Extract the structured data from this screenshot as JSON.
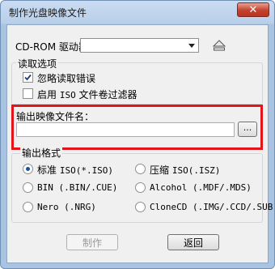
{
  "window": {
    "title": "制作光盘映像文件",
    "close_glyph": "✕"
  },
  "drive": {
    "label": "CD-ROM 驱动器：",
    "value": "",
    "eject_icon": "eject-icon"
  },
  "read_options": {
    "legend": "读取选项",
    "ignore_errors": {
      "label": "忽略读取错误",
      "checked": true
    },
    "iso_filter": {
      "label_prefix": "启用 ",
      "label_iso": "ISO",
      "label_suffix": " 文件卷过滤器",
      "checked": false
    }
  },
  "output_file": {
    "label": "输出映像文件名：",
    "value": "",
    "browse_label": "..."
  },
  "output_format": {
    "legend": "输出格式",
    "options": [
      {
        "label": "标准 ",
        "ext": "ISO(*.ISO)",
        "selected": true
      },
      {
        "label": "压缩 ",
        "ext": "ISO(.ISZ)",
        "selected": false
      },
      {
        "label": "",
        "ext": "BIN (.BIN/.CUE)",
        "selected": false
      },
      {
        "label": "",
        "ext": "Alcohol (.MDF/.MDS)",
        "selected": false
      },
      {
        "label": "",
        "ext": "Nero (.NRG)",
        "selected": false
      },
      {
        "label": "",
        "ext": "CloneCD (.IMG/.CCD/.SUB)",
        "selected": false
      }
    ]
  },
  "buttons": {
    "make": "制作",
    "back": "返回"
  },
  "colors": {
    "highlight": "#e3141a",
    "titlebar": "#b9cfe9",
    "close": "#c4412e"
  }
}
